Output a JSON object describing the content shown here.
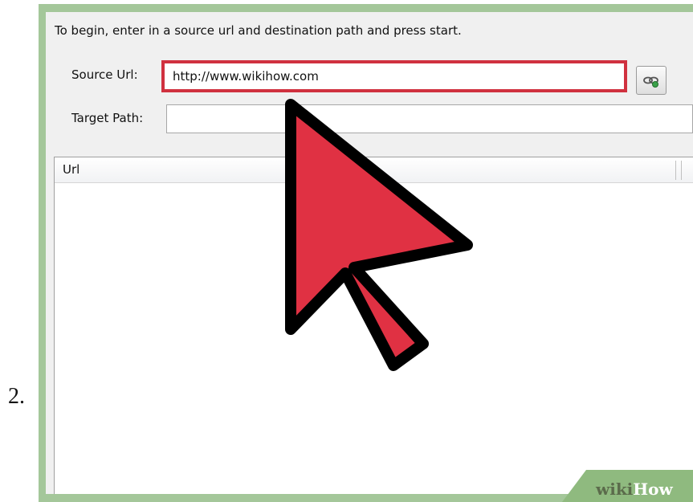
{
  "step": {
    "number": "2."
  },
  "dialog": {
    "instruction": "To begin, enter in a source url and destination path and press start.",
    "source": {
      "label": "Source Url:",
      "value": "http://www.wikihow.com"
    },
    "target": {
      "label": "Target Path:",
      "value": ""
    },
    "browse_icon": "link-icon",
    "table": {
      "columns": [
        "Url"
      ],
      "rows": []
    }
  },
  "overlay": {
    "cursor_icon": "arrow-cursor-icon",
    "cursor_color": "#e03143"
  },
  "watermark": {
    "wiki": "wiki",
    "how": "How"
  },
  "colors": {
    "highlight": "#d0313f",
    "frame": "#a4c79a",
    "watermark_badge": "#8fba7f"
  }
}
